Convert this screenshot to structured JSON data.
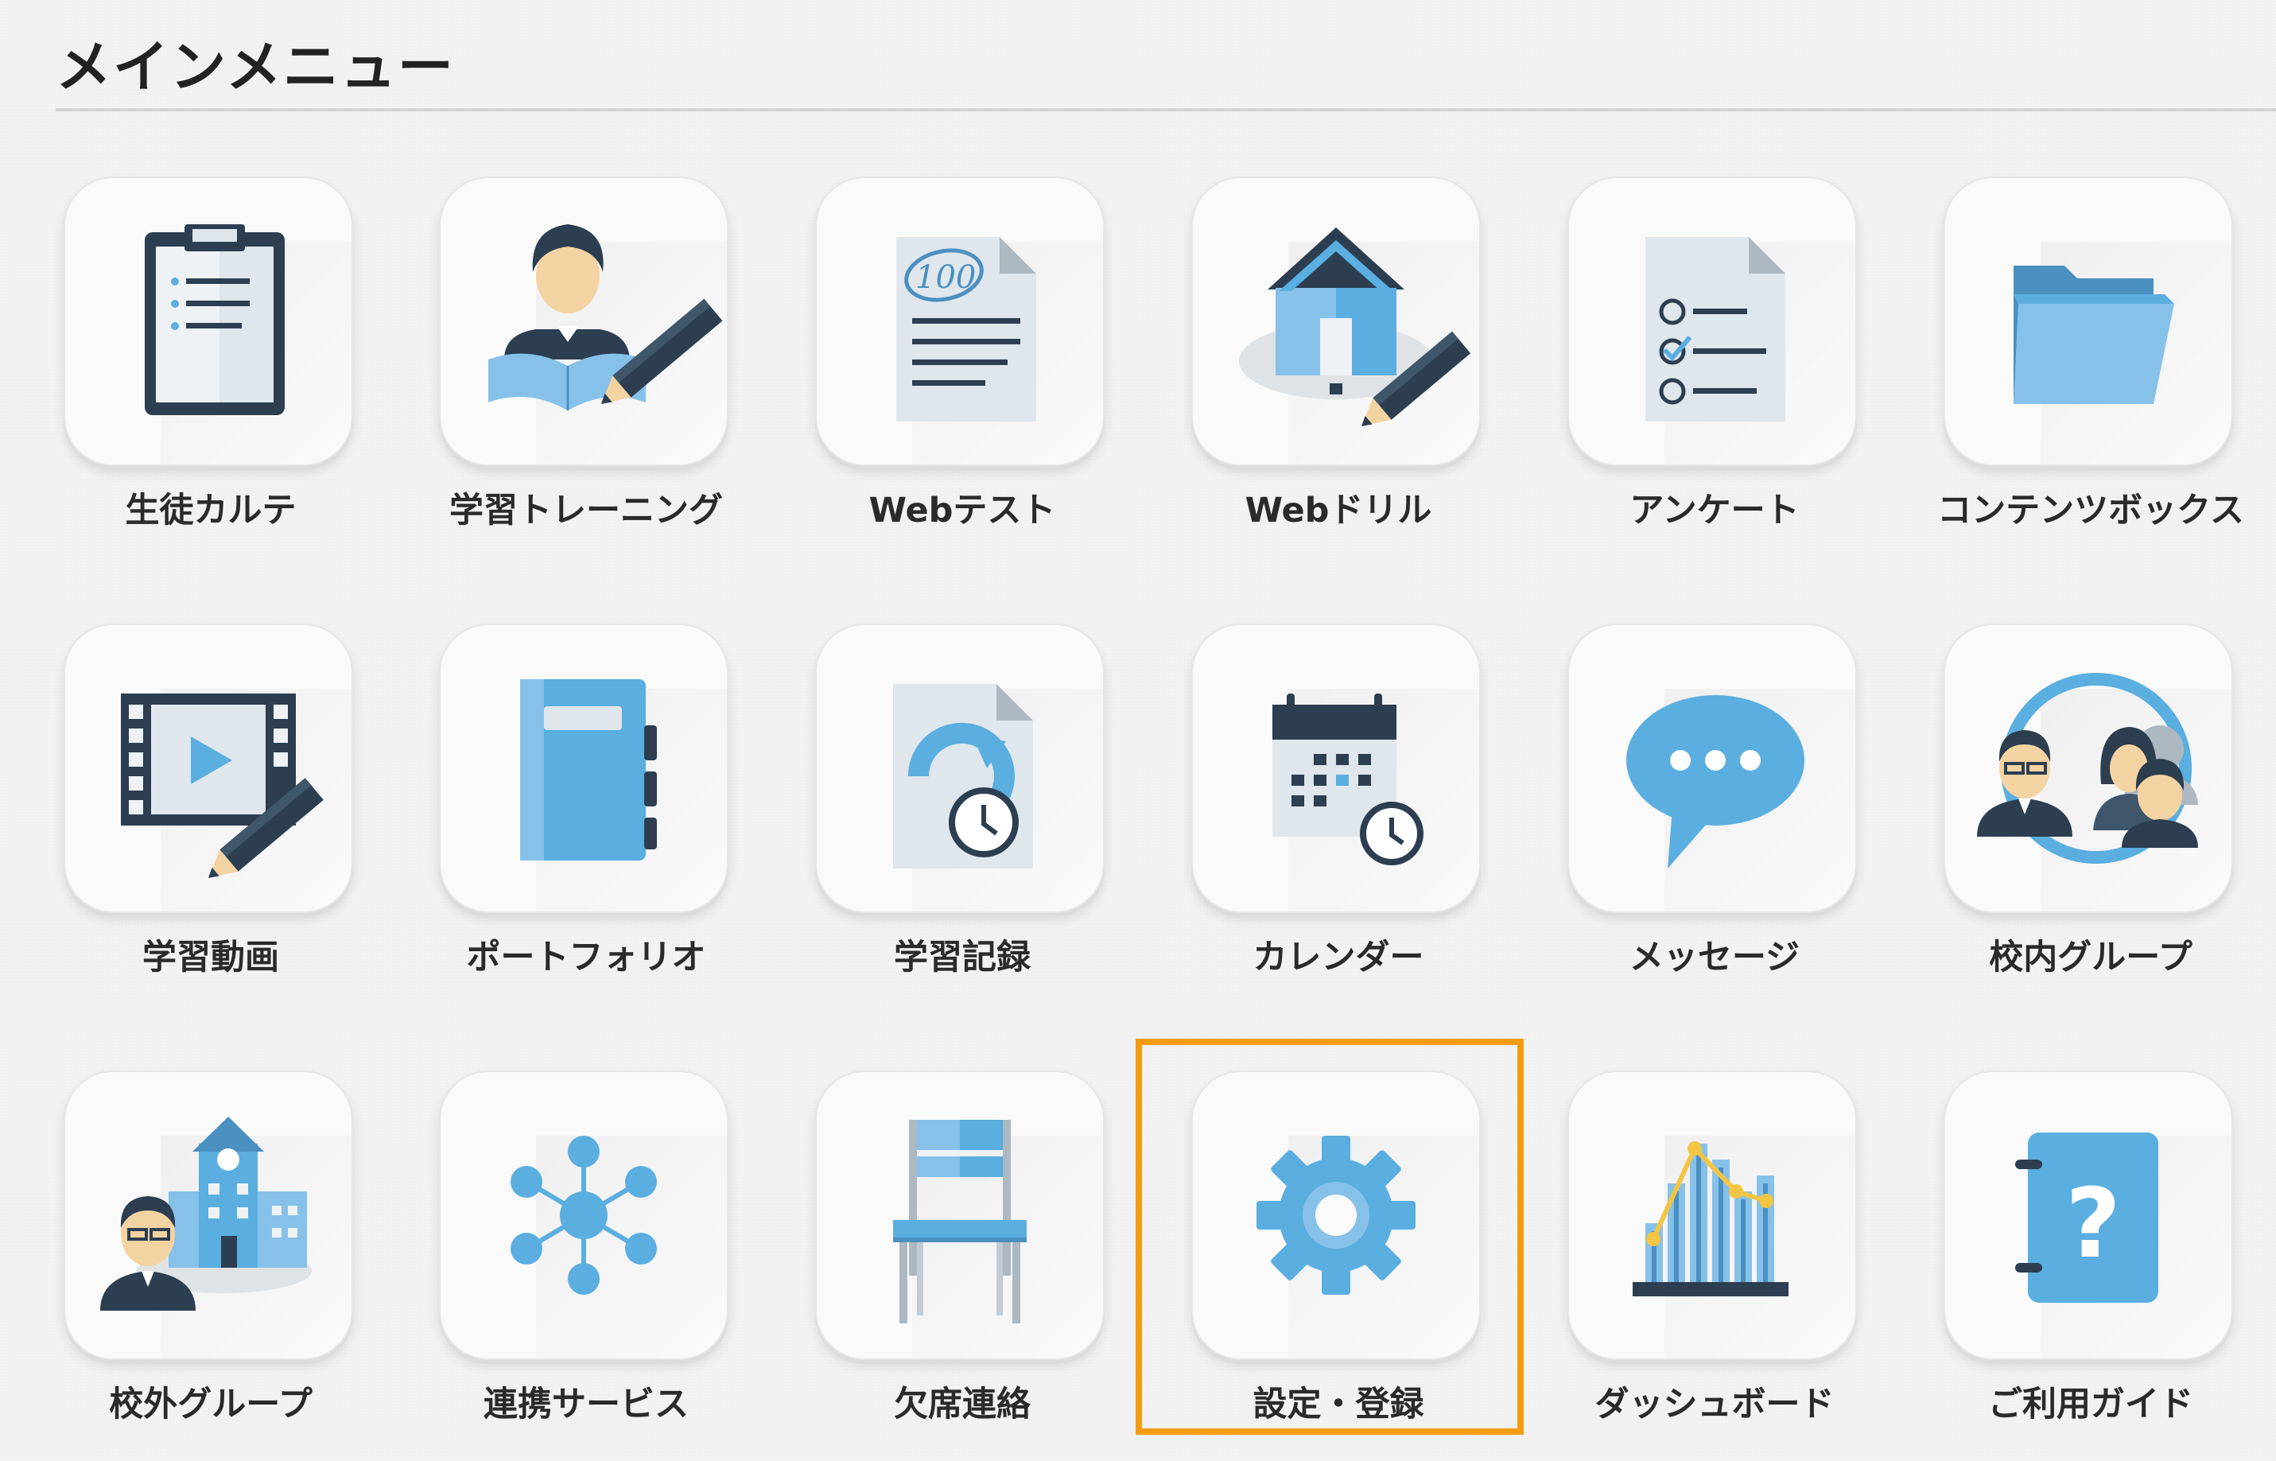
{
  "page": {
    "title": "メインメニュー"
  },
  "menu": {
    "items": [
      {
        "label": "生徒カルテ",
        "icon": "clipboard-icon"
      },
      {
        "label": "学習トレーニング",
        "icon": "student-reading-pencil-icon"
      },
      {
        "label": "Webテスト",
        "icon": "test-score-document-icon"
      },
      {
        "label": "Webドリル",
        "icon": "home-pencil-icon"
      },
      {
        "label": "アンケート",
        "icon": "checklist-document-icon"
      },
      {
        "label": "コンテンツボックス",
        "icon": "folder-icon"
      },
      {
        "label": "学習動画",
        "icon": "video-film-pencil-icon"
      },
      {
        "label": "ポートフォリオ",
        "icon": "notebook-icon"
      },
      {
        "label": "学習記録",
        "icon": "document-history-clock-icon"
      },
      {
        "label": "カレンダー",
        "icon": "calendar-clock-icon"
      },
      {
        "label": "メッセージ",
        "icon": "speech-bubble-icon"
      },
      {
        "label": "校内グループ",
        "icon": "group-people-icon"
      },
      {
        "label": "校外グループ",
        "icon": "school-building-person-icon"
      },
      {
        "label": "連携サービス",
        "icon": "network-hub-icon"
      },
      {
        "label": "欠席連絡",
        "icon": "chair-icon"
      },
      {
        "label": "設定・登録",
        "icon": "gear-icon"
      },
      {
        "label": "ダッシュボード",
        "icon": "bar-line-chart-icon"
      },
      {
        "label": "ご利用ガイド",
        "icon": "help-book-icon"
      }
    ],
    "highlighted_item": "設定・登録"
  },
  "colors": {
    "accent_highlight": "#f39c12",
    "icon_blue": "#5aaee0",
    "icon_light_blue": "#86c1ea",
    "icon_dark": "#2c3e50",
    "icon_gray": "#d5dadf"
  }
}
